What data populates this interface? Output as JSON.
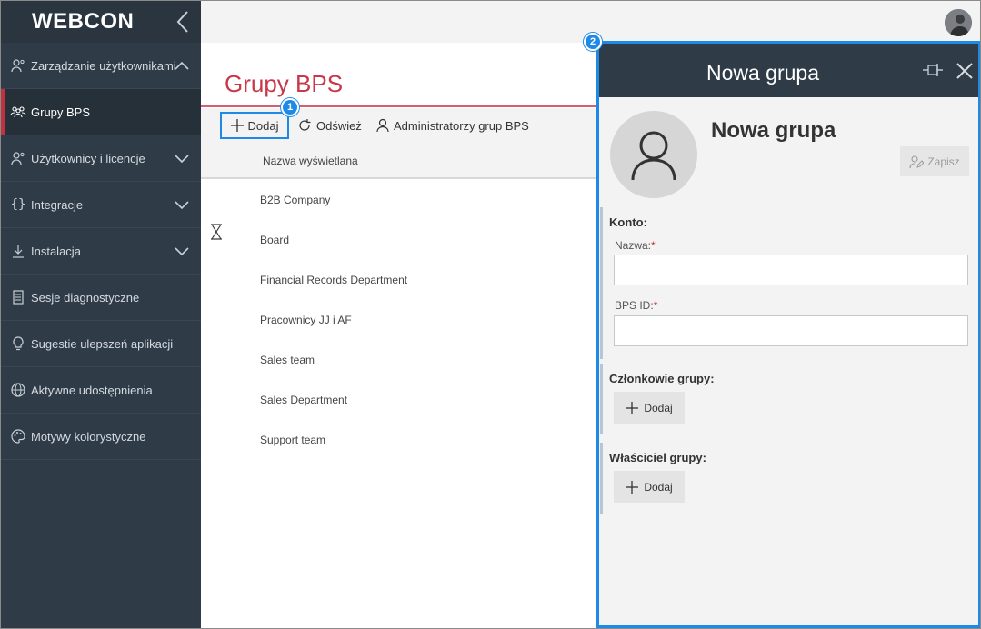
{
  "app": {
    "logo": "WEBCON"
  },
  "sidebar": {
    "items": [
      {
        "label": "Zarządzanie użytkownikami",
        "icon": "user-admin-icon",
        "expanded": true
      },
      {
        "label": "Grupy BPS",
        "icon": "group-icon",
        "active": true
      },
      {
        "label": "Użytkownicy i licencje",
        "icon": "user-license-icon",
        "expanded": false
      },
      {
        "label": "Integracje",
        "icon": "braces-icon",
        "expanded": false
      },
      {
        "label": "Instalacja",
        "icon": "download-icon",
        "expanded": false
      },
      {
        "label": "Sesje diagnostyczne",
        "icon": "document-icon"
      },
      {
        "label": "Sugestie ulepszeń aplikacji",
        "icon": "lightbulb-icon"
      },
      {
        "label": "Aktywne udostępnienia",
        "icon": "globe-icon"
      },
      {
        "label": "Motywy kolorystyczne",
        "icon": "palette-icon"
      }
    ]
  },
  "main": {
    "title": "Grupy BPS",
    "toolbar": {
      "add": "Dodaj",
      "refresh": "Odśwież",
      "admins": "Administratorzy grup BPS"
    },
    "column_header": "Nazwa wyświetlana",
    "rows": [
      "B2B Company",
      "Board",
      "Financial Records Department",
      "Pracownicy JJ i AF",
      "Sales team",
      "Sales Department",
      "Support team"
    ]
  },
  "panel": {
    "title": "Nowa grupa",
    "group_name": "Nowa grupa",
    "save": "Zapisz",
    "account": {
      "title": "Konto:",
      "name_label": "Nazwa:",
      "name_value": "",
      "bpsid_label": "BPS ID:",
      "bpsid_value": "",
      "required_mark": "*"
    },
    "members": {
      "title": "Członkowie grupy:",
      "add": "Dodaj"
    },
    "owner": {
      "title": "Właściciel grupy:",
      "add": "Dodaj"
    }
  },
  "badges": {
    "first": "1",
    "second": "2"
  },
  "colors": {
    "accent": "#1e8ae6",
    "brand_red": "#c8374a",
    "sidebar_bg": "#2f3b47"
  }
}
